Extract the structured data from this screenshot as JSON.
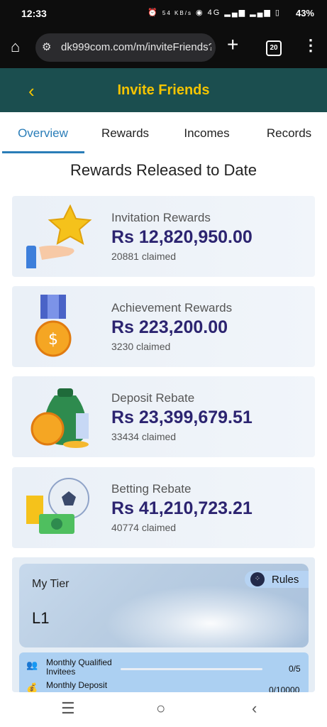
{
  "status": {
    "time": "12:33",
    "net": "54 KB/s",
    "signal": "4G",
    "battery": "43%"
  },
  "browser": {
    "url": "dk999com.com/m/inviteFriends?",
    "tab_count": "20"
  },
  "header": {
    "title": "Invite Friends",
    "back_icon": "chevron-left-icon"
  },
  "tabs": [
    {
      "label": "Overview",
      "active": true
    },
    {
      "label": "Rewards"
    },
    {
      "label": "Incomes"
    },
    {
      "label": "Records"
    }
  ],
  "section_title": "Rewards Released to Date",
  "cards": [
    {
      "label": "Invitation Rewards",
      "amount": "Rs 12,820,950.00",
      "claimed": "20881 claimed",
      "icon": "star-hand-icon"
    },
    {
      "label": "Achievement Rewards",
      "amount": "Rs 223,200.00",
      "claimed": "3230 claimed",
      "icon": "medal-icon"
    },
    {
      "label": "Deposit Rebate",
      "amount": "Rs 23,399,679.51",
      "claimed": "33434 claimed",
      "icon": "money-bag-icon"
    },
    {
      "label": "Betting Rebate",
      "amount": "Rs 41,210,723.21",
      "claimed": "40774 claimed",
      "icon": "ball-cash-icon"
    }
  ],
  "tier": {
    "label": "My Tier",
    "level": "L1",
    "rules": "Rules"
  },
  "qualification": [
    {
      "label1": "Monthly Qualified",
      "label2": "Invitees",
      "value": "0/5",
      "progress": 0
    },
    {
      "label1": "Monthly Deposit",
      "label2": "",
      "value": "0/10000",
      "progress": 0
    }
  ]
}
